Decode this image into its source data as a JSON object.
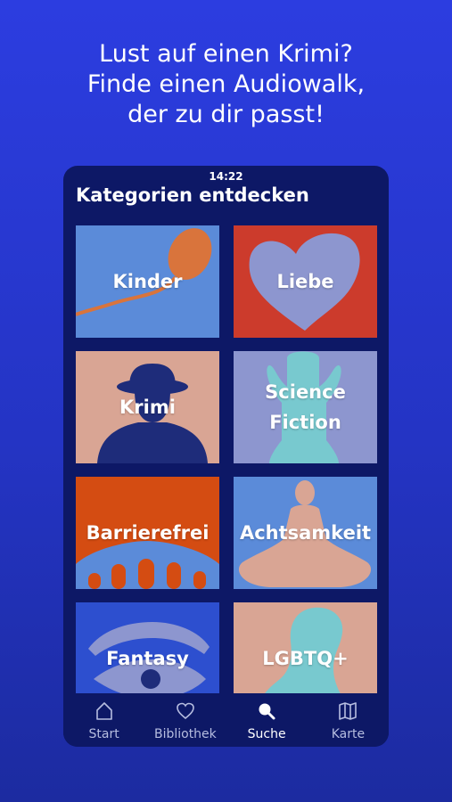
{
  "promo": {
    "line1": "Lust auf einen Krimi?",
    "line2": "Finde einen Audiowalk,",
    "line3": "der zu dir passt!"
  },
  "status": {
    "time": "14:22"
  },
  "screen": {
    "title": "Kategorien entdecken"
  },
  "categories": [
    {
      "label": "Kinder",
      "icon": "balloon-icon",
      "bg": "#5b8bd9"
    },
    {
      "label": "Liebe",
      "icon": "heart-icon",
      "bg": "#cc3b2c"
    },
    {
      "label": "Krimi",
      "icon": "detective-icon",
      "bg": "#d9a594"
    },
    {
      "label": "Science\nFiction",
      "icon": "alien-icon",
      "bg": "#8d96cf"
    },
    {
      "label": "Barrierefrei",
      "icon": "bridge-icon",
      "bg": "#d44c12"
    },
    {
      "label": "Achtsamkeit",
      "icon": "meditation-icon",
      "bg": "#5b8bd9"
    },
    {
      "label": "Fantasy",
      "icon": "eye-icon",
      "bg": "#2d4fcf"
    },
    {
      "label": "LGBTQ+",
      "icon": "figure-icon",
      "bg": "#d9a594"
    }
  ],
  "tabs": [
    {
      "label": "Start",
      "icon": "home-icon",
      "active": false
    },
    {
      "label": "Bibliothek",
      "icon": "heart-outline-icon",
      "active": false
    },
    {
      "label": "Suche",
      "icon": "search-icon",
      "active": true
    },
    {
      "label": "Karte",
      "icon": "map-icon",
      "active": false
    }
  ],
  "colors": {
    "background": "#2c3de0",
    "phone": "#0d1866",
    "text": "#ffffff",
    "tab_inactive": "#b6bde0"
  }
}
